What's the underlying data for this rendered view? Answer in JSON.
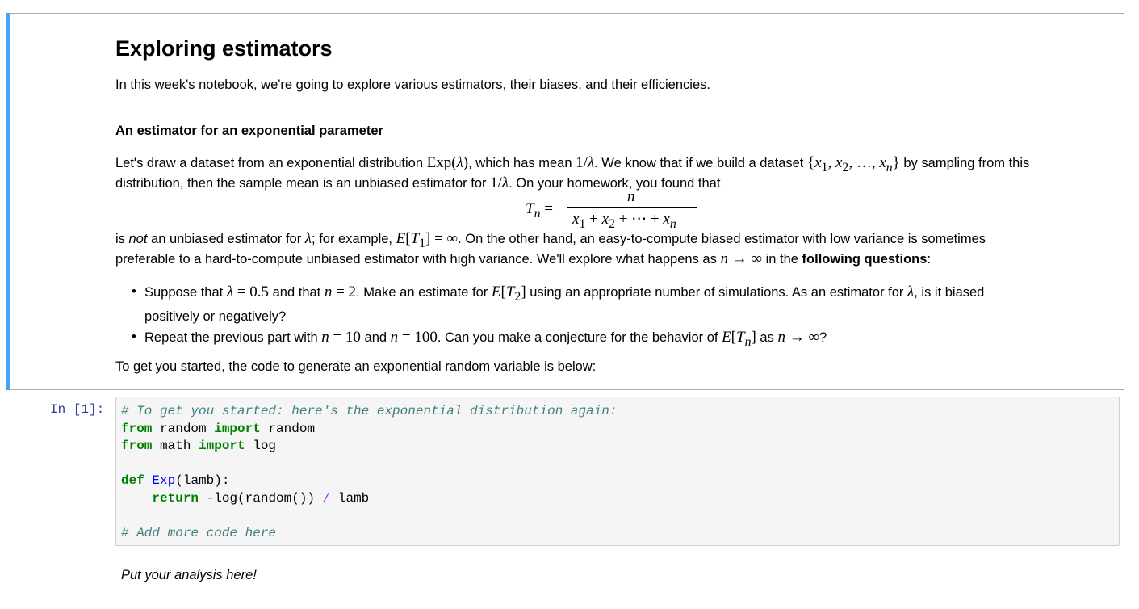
{
  "markdown": {
    "title": "Exploring estimators",
    "intro": "In this week's notebook, we're going to explore various estimators, their biases, and their efficiencies.",
    "subheading": "An estimator for an exponential parameter",
    "p1_a": "Let's draw a dataset from an exponential distribution ",
    "p1_b": ", which has mean ",
    "p1_c": ". We know that if we build a dataset ",
    "p1_d": " by sampling from this",
    "p2_a": "distribution, then the sample mean is an unbiased estimator for ",
    "p2_b": ". On your homework, you found that",
    "p3_a": "is ",
    "p3_not": "not",
    "p3_b": " an unbiased estimator for ",
    "p3_c": "; for example, ",
    "p3_d": ". On the other hand, an easy-to-compute biased estimator with low variance is sometimes",
    "p4_a": "preferable to a hard-to-compute unbiased estimator with high variance. We'll explore what happens as ",
    "p4_b": " in the ",
    "p4_bold": "following questions",
    "p4_c": ":",
    "b1_a": "Suppose that ",
    "b1_b": " and that ",
    "b1_c": ". Make an estimate for ",
    "b1_d": " using an appropriate number of simulations. As an estimator for ",
    "b1_e": ", is it biased",
    "b1_f": "positively or negatively?",
    "b2_a": "Repeat the previous part with ",
    "b2_b": " and ",
    "b2_c": ". Can you make a conjecture for the behavior of ",
    "b2_d": " as ",
    "b2_e": "?",
    "closing": "To get you started, the code to generate an exponential random variable is below:"
  },
  "code_cell": {
    "prompt": "In [1]:",
    "comment1": "# To get you started: here's the exponential distribution again:",
    "comment2": "# Add more code here"
  },
  "analysis_text": "Put your analysis here!",
  "colors": {
    "accent_bar": "#42a5f5",
    "prompt": "#303f9f",
    "code_bg": "#f5f5f5"
  }
}
